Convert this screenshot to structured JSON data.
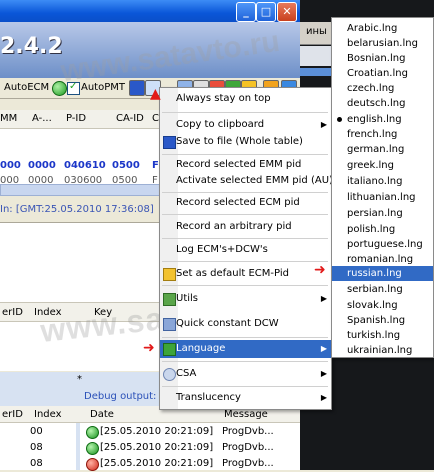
{
  "window": {
    "version": "2.4.2",
    "minimize_icon": "minimize-icon",
    "maximize_icon": "maximize-icon",
    "close_icon": "close-icon"
  },
  "right_strip": {
    "text": "ины"
  },
  "toolbar": {
    "auto_ecm": "AutoECM",
    "auto_pmt": "AutoPMT"
  },
  "grid": {
    "headers": [
      "MM",
      "A-...",
      "P-ID",
      "CA-ID",
      "C"
    ],
    "rows": [
      [
        "000",
        "0000",
        "040610",
        "0500",
        "F"
      ],
      [
        "000",
        "0000",
        "030600",
        "0500",
        "F"
      ]
    ]
  },
  "status": "In: [GMT:25.05.2010 17:36:08]",
  "list2": {
    "headers": [
      "erID",
      "Index",
      "Key"
    ]
  },
  "bottom": {
    "star": "*",
    "debug_label": "Debug output:",
    "left_headers": [
      "erID",
      "Index"
    ],
    "left_rows": [
      [
        "",
        "00"
      ],
      [
        "",
        "08"
      ],
      [
        "",
        "08"
      ]
    ],
    "log_headers": [
      "Date",
      "Message"
    ],
    "log_rows": [
      {
        "status": "ok",
        "date": "[25.05.2010 20:21:09]",
        "message": "ProgDvb..."
      },
      {
        "status": "ok",
        "date": "[25.05.2010 20:21:09]",
        "message": "ProgDvb..."
      },
      {
        "status": "error",
        "date": "[25.05.2010 20:21:09]",
        "message": "ProgDvb..."
      }
    ]
  },
  "menu": {
    "items": [
      {
        "label": "Always stay on top",
        "submenu": false
      },
      {
        "label": "Copy to clipboard",
        "submenu": true
      },
      {
        "label": "Save to file (Whole table)",
        "submenu": false
      },
      {
        "label": "Record selected EMM pid",
        "submenu": false
      },
      {
        "label": "Activate selected EMM pid (AU)",
        "submenu": false
      },
      {
        "label": "Record selected ECM pid",
        "submenu": false
      },
      {
        "label": "Record an arbitrary pid",
        "submenu": false
      },
      {
        "label": "Log ECM's+DCW's",
        "submenu": false
      },
      {
        "label": "Set as default ECM-Pid",
        "submenu": false
      },
      {
        "label": "Utils",
        "submenu": true
      },
      {
        "label": "Quick constant DCW",
        "submenu": false
      },
      {
        "label": "Language",
        "submenu": true
      },
      {
        "label": "CSA",
        "submenu": true
      },
      {
        "label": "Translucency",
        "submenu": true
      }
    ],
    "highlighted": "Language"
  },
  "languages": {
    "items": [
      "Arabic.lng",
      "belarusian.lng",
      "Bosnian.lng",
      "Croatian.lng",
      "czech.lng",
      "deutsch.lng",
      "english.lng",
      "french.lng",
      "german.lng",
      "greek.lng",
      "italiano.lng",
      "lithuanian.lng",
      "persian.lng",
      "polish.lng",
      "portuguese.lng",
      "romanian.lng",
      "russian.lng",
      "serbian.lng",
      "slovak.lng",
      "Spanish.lng",
      "turkish.lng",
      "ukrainian.lng"
    ],
    "checked": "english.lng",
    "highlighted": "russian.lng"
  },
  "watermark": "www.satavto.ru",
  "colors": {
    "menu_highlight": "#316ac5",
    "titlebar": "#0a56d8",
    "arrow": "#e21a1a",
    "grid_text": "#1b36c8"
  }
}
